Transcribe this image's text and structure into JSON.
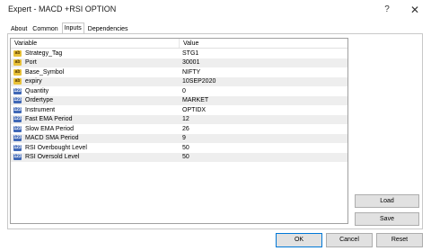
{
  "window": {
    "title": "Expert - MACD +RSI OPTION",
    "help_glyph": "?",
    "close_glyph": "✕"
  },
  "tabs": [
    {
      "label": "About"
    },
    {
      "label": "Common"
    },
    {
      "label": "Inputs"
    },
    {
      "label": "Dependencies"
    }
  ],
  "grid": {
    "header_variable": "Variable",
    "header_value": "Value",
    "rows": [
      {
        "icon": "ab",
        "name": "Strategy_Tag",
        "value": "STG1"
      },
      {
        "icon": "ab",
        "name": "Port",
        "value": "30001"
      },
      {
        "icon": "ab",
        "name": "Base_Symbol",
        "value": "NIFTY"
      },
      {
        "icon": "ab",
        "name": "expiry",
        "value": "10SEP2020"
      },
      {
        "icon": "123",
        "name": "Quantity",
        "value": "0"
      },
      {
        "icon": "123",
        "name": "Ordertype",
        "value": "MARKET"
      },
      {
        "icon": "123",
        "name": "Instrument",
        "value": "OPTIDX"
      },
      {
        "icon": "123",
        "name": "Fast EMA Period",
        "value": "12"
      },
      {
        "icon": "123",
        "name": "Slow EMA Period",
        "value": "26"
      },
      {
        "icon": "123",
        "name": "MACD SMA Period",
        "value": "9"
      },
      {
        "icon": "123",
        "name": "RSI Overbought Level",
        "value": "50"
      },
      {
        "icon": "123",
        "name": "RSI Oversold Level",
        "value": "50"
      }
    ]
  },
  "buttons": {
    "load": "Load",
    "save": "Save",
    "ok": "OK",
    "cancel": "Cancel",
    "reset": "Reset"
  }
}
